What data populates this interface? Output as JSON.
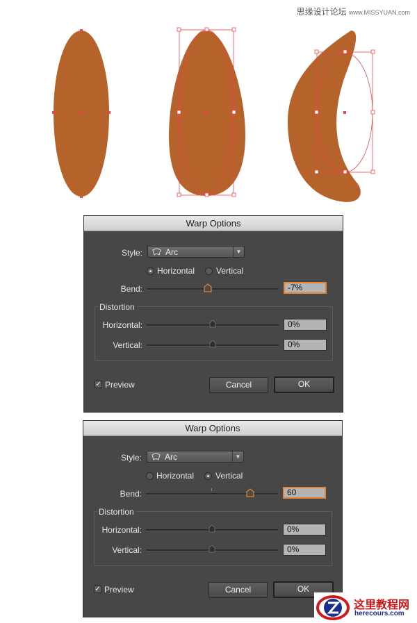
{
  "watermark": {
    "site_cn": "思缘设计论坛",
    "site_url": "www.MISSYUAN.com"
  },
  "logo": {
    "title_cn": "这里教程网",
    "url": "herecours.com"
  },
  "colors": {
    "shape_fill": "#b5632a",
    "anchor": "#e8474b",
    "dialog_bg": "#474747",
    "focus": "#e8832f"
  },
  "dialogs": [
    {
      "title": "Warp Options",
      "style_label": "Style:",
      "style_value": "Arc",
      "orient_horizontal": "Horizontal",
      "orient_vertical": "Vertical",
      "orientation": "Horizontal",
      "bend_label": "Bend:",
      "bend_value": "-7%",
      "bend_percent": -7,
      "distortion_label": "Distortion",
      "dist_h_label": "Horizontal:",
      "dist_h_value": "0%",
      "dist_v_label": "Vertical:",
      "dist_v_value": "0%",
      "preview_label": "Preview",
      "preview_checked": true,
      "cancel_label": "Cancel",
      "ok_label": "OK"
    },
    {
      "title": "Warp Options",
      "style_label": "Style:",
      "style_value": "Arc",
      "orient_horizontal": "Horizontal",
      "orient_vertical": "Vertical",
      "orientation": "Vertical",
      "bend_label": "Bend:",
      "bend_value": "60",
      "bend_percent": 60,
      "distortion_label": "Distortion",
      "dist_h_label": "Horizontal:",
      "dist_h_value": "0%",
      "dist_v_label": "Vertical:",
      "dist_v_value": "0%",
      "preview_label": "Preview",
      "preview_checked": true,
      "cancel_label": "Cancel",
      "ok_label": "OK"
    }
  ]
}
